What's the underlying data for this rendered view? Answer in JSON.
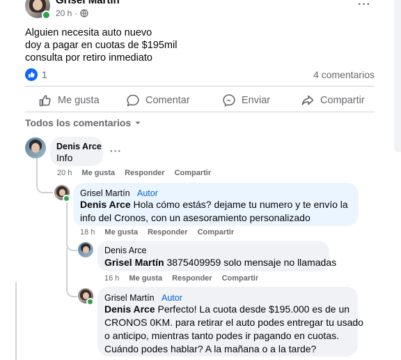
{
  "post": {
    "author": "Grisel Martín",
    "time": "20 h",
    "lines": [
      "Alguien necesita auto nuevo",
      "doy a pagar en cuotas de $195mil",
      "consulta por retiro inmediato"
    ],
    "reactions_count": "1",
    "comments_count": "4 comentarios"
  },
  "actions": {
    "like": "Me gusta",
    "comment": "Comentar",
    "send": "Enviar",
    "share": "Compartir"
  },
  "filter": {
    "label": "Todos los comentarios"
  },
  "comments": [
    {
      "name": "Denis Arce",
      "text": "Info",
      "time": "20 h",
      "like": "Me gusta",
      "reply": "Responder",
      "share": "Compartir"
    },
    {
      "name": "Grisel Martín",
      "badge": "Autor",
      "mention": "Denis Arce",
      "text_line1": " Hola cómo estás? dejame tu numero y te envío la",
      "text_line2": "info del Cronos, con un asesoramiento personalizado",
      "time": "18 h",
      "like": "Me gusta",
      "reply": "Responder",
      "share": "Compartir"
    },
    {
      "name": "Denis Arce",
      "mention": "Grisel Martín",
      "text": " 3875409959 solo mensaje no llamadas",
      "time": "16 h",
      "like": "Me gusta",
      "reply": "Responder",
      "share": "Compartir"
    },
    {
      "name": "Grisel Martín",
      "badge": "Autor",
      "mention": "Denis Arce",
      "text_line1": " Perfecto! La cuota desde $195.000 es de un",
      "text_line2": "CRONOS 0KM. para retirar el auto podes entregar tu usado",
      "text_line3": "o anticipo, mientras tanto podes ir pagando en cuotas.",
      "text_line4": "Cuándo podes hablar? A la mañana o a la tarde?"
    }
  ],
  "colors": {
    "like_blue": "#0866ff",
    "author_blue": "#0064d1",
    "online_green": "#31a24c",
    "meta_gray": "#65676b"
  }
}
